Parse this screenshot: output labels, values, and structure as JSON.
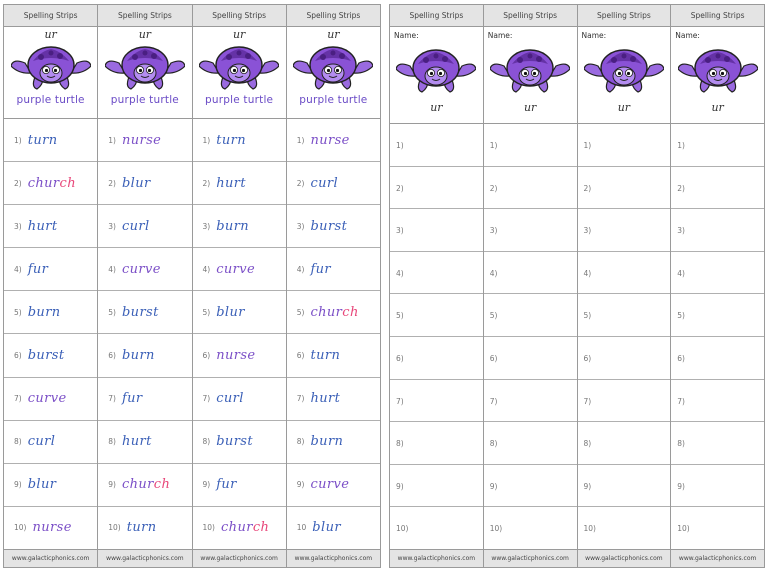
{
  "header_label": "Spelling Strips",
  "footer_label": "www.galacticphonics.com",
  "sound": "ur",
  "caption": "purple turtle",
  "name_label": "Name:",
  "colors": {
    "word": "#3a5fb7",
    "highlight": "#e8477a",
    "purple_word": "#7b4fc7",
    "turtle": "#8a52d6"
  },
  "left_columns": [
    {
      "rows": [
        {
          "num": "1)",
          "pre": "turn",
          "hl": "",
          "post": "",
          "cls": ""
        },
        {
          "num": "2)",
          "pre": "chur",
          "hl": "ch",
          "post": "",
          "cls": "pur"
        },
        {
          "num": "3)",
          "pre": "hurt",
          "hl": "",
          "post": "",
          "cls": ""
        },
        {
          "num": "4)",
          "pre": "fur",
          "hl": "",
          "post": "",
          "cls": ""
        },
        {
          "num": "5)",
          "pre": "burn",
          "hl": "",
          "post": "",
          "cls": ""
        },
        {
          "num": "6)",
          "pre": "burst",
          "hl": "",
          "post": "",
          "cls": ""
        },
        {
          "num": "7)",
          "pre": "curve",
          "hl": "",
          "post": "",
          "cls": "pur"
        },
        {
          "num": "8)",
          "pre": "curl",
          "hl": "",
          "post": "",
          "cls": ""
        },
        {
          "num": "9)",
          "pre": "blur",
          "hl": "",
          "post": "",
          "cls": ""
        },
        {
          "num": "10)",
          "pre": "nurse",
          "hl": "",
          "post": "",
          "cls": "pur"
        }
      ]
    },
    {
      "rows": [
        {
          "num": "1)",
          "pre": "nurse",
          "hl": "",
          "post": "",
          "cls": "pur"
        },
        {
          "num": "2)",
          "pre": "blur",
          "hl": "",
          "post": "",
          "cls": ""
        },
        {
          "num": "3)",
          "pre": "curl",
          "hl": "",
          "post": "",
          "cls": ""
        },
        {
          "num": "4)",
          "pre": "curve",
          "hl": "",
          "post": "",
          "cls": "pur"
        },
        {
          "num": "5)",
          "pre": "burst",
          "hl": "",
          "post": "",
          "cls": ""
        },
        {
          "num": "6)",
          "pre": "burn",
          "hl": "",
          "post": "",
          "cls": ""
        },
        {
          "num": "7)",
          "pre": "fur",
          "hl": "",
          "post": "",
          "cls": ""
        },
        {
          "num": "8)",
          "pre": "hurt",
          "hl": "",
          "post": "",
          "cls": ""
        },
        {
          "num": "9)",
          "pre": "chur",
          "hl": "ch",
          "post": "",
          "cls": "pur"
        },
        {
          "num": "10)",
          "pre": "turn",
          "hl": "",
          "post": "",
          "cls": ""
        }
      ]
    },
    {
      "rows": [
        {
          "num": "1)",
          "pre": "turn",
          "hl": "",
          "post": "",
          "cls": ""
        },
        {
          "num": "2)",
          "pre": "hurt",
          "hl": "",
          "post": "",
          "cls": ""
        },
        {
          "num": "3)",
          "pre": "burn",
          "hl": "",
          "post": "",
          "cls": ""
        },
        {
          "num": "4)",
          "pre": "curve",
          "hl": "",
          "post": "",
          "cls": "pur"
        },
        {
          "num": "5)",
          "pre": "blur",
          "hl": "",
          "post": "",
          "cls": ""
        },
        {
          "num": "6)",
          "pre": "nurse",
          "hl": "",
          "post": "",
          "cls": "pur"
        },
        {
          "num": "7)",
          "pre": "curl",
          "hl": "",
          "post": "",
          "cls": ""
        },
        {
          "num": "8)",
          "pre": "burst",
          "hl": "",
          "post": "",
          "cls": ""
        },
        {
          "num": "9)",
          "pre": "fur",
          "hl": "",
          "post": "",
          "cls": ""
        },
        {
          "num": "10)",
          "pre": "chur",
          "hl": "ch",
          "post": "",
          "cls": "pur"
        }
      ]
    },
    {
      "rows": [
        {
          "num": "1)",
          "pre": "nurse",
          "hl": "",
          "post": "",
          "cls": "pur"
        },
        {
          "num": "2)",
          "pre": "curl",
          "hl": "",
          "post": "",
          "cls": ""
        },
        {
          "num": "3)",
          "pre": "burst",
          "hl": "",
          "post": "",
          "cls": ""
        },
        {
          "num": "4)",
          "pre": "fur",
          "hl": "",
          "post": "",
          "cls": ""
        },
        {
          "num": "5)",
          "pre": "chur",
          "hl": "ch",
          "post": "",
          "cls": "pur"
        },
        {
          "num": "6)",
          "pre": "turn",
          "hl": "",
          "post": "",
          "cls": ""
        },
        {
          "num": "7)",
          "pre": "hurt",
          "hl": "",
          "post": "",
          "cls": ""
        },
        {
          "num": "8)",
          "pre": "burn",
          "hl": "",
          "post": "",
          "cls": ""
        },
        {
          "num": "9)",
          "pre": "curve",
          "hl": "",
          "post": "",
          "cls": "pur"
        },
        {
          "num": "10",
          "pre": "blur",
          "hl": "",
          "post": "",
          "cls": ""
        }
      ]
    }
  ],
  "right_numbers": [
    "1)",
    "2)",
    "3)",
    "4)",
    "5)",
    "6)",
    "7)",
    "8)",
    "9)",
    "10)"
  ]
}
